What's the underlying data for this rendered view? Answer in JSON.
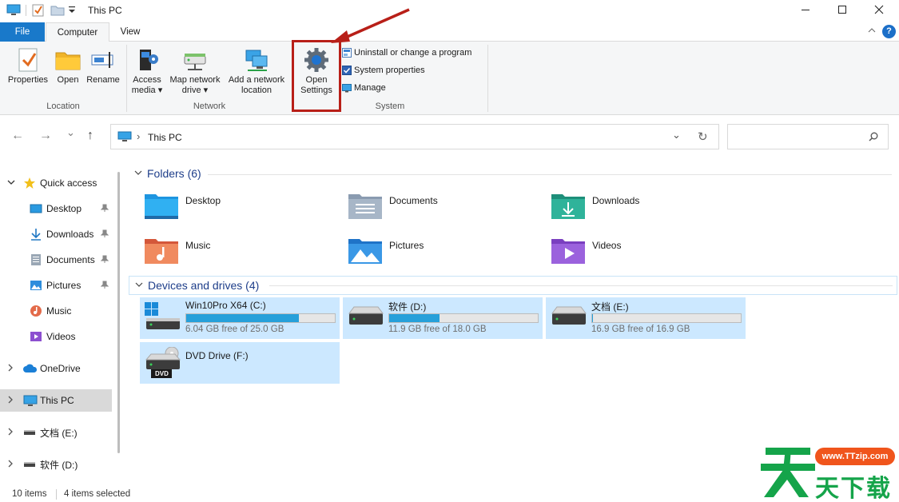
{
  "window": {
    "title": "This PC",
    "minimize": "—",
    "maximize": "☐",
    "close": "✕"
  },
  "ribbon": {
    "tabs": [
      {
        "label": "File"
      },
      {
        "label": "Computer"
      },
      {
        "label": "View"
      }
    ],
    "collapse": "^",
    "help": "?",
    "location": {
      "group_label": "Location",
      "properties": "Properties",
      "open": "Open",
      "rename": "Rename"
    },
    "network": {
      "group_label": "Network",
      "access_media_1": "Access",
      "access_media_2": "media ▾",
      "map_drive_1": "Map network",
      "map_drive_2": "drive ▾",
      "add_location_1": "Add a network",
      "add_location_2": "location"
    },
    "system": {
      "group_label": "System",
      "open_settings_1": "Open",
      "open_settings_2": "Settings",
      "uninstall": "Uninstall or change a program",
      "system_properties": "System properties",
      "manage": "Manage"
    }
  },
  "nav": {
    "back": "←",
    "forward": "→",
    "recent": "⌄",
    "up": "↑",
    "address": "This PC",
    "address_sep": "›",
    "dropdown": "⌄",
    "refresh": "↻",
    "search_placeholder": "",
    "search_glyph": "⚲"
  },
  "navpane": {
    "items": [
      {
        "label": "Quick access",
        "expanded": true
      },
      {
        "label": "Desktop",
        "pinned": true
      },
      {
        "label": "Downloads",
        "pinned": true
      },
      {
        "label": "Documents",
        "pinned": true
      },
      {
        "label": "Pictures",
        "pinned": true
      },
      {
        "label": "Music"
      },
      {
        "label": "Videos"
      },
      {
        "label": "OneDrive"
      },
      {
        "label": "This PC",
        "selected": true
      },
      {
        "label": "文档 (E:)"
      },
      {
        "label": "软件 (D:)"
      }
    ],
    "pin_glyph": "📌",
    "chev_down": "⌄",
    "chev_right": "›"
  },
  "content": {
    "folders_header": "Folders (6)",
    "folders": [
      {
        "label": "Desktop",
        "color": "#1e95e0"
      },
      {
        "label": "Documents",
        "color": "#8a9bb0"
      },
      {
        "label": "Downloads",
        "color": "#27a38c"
      },
      {
        "label": "Music",
        "color": "#e36b4a"
      },
      {
        "label": "Pictures",
        "color": "#2d8ddc"
      },
      {
        "label": "Videos",
        "color": "#8c4fd0"
      }
    ],
    "drives_header": "Devices and drives (4)",
    "drives": [
      {
        "name": "Win10Pro X64 (C:)",
        "free": "6.04 GB free of 25.0 GB",
        "used_fraction": 0.758
      },
      {
        "name": "软件 (D:)",
        "free": "11.9 GB free of 18.0 GB",
        "used_fraction": 0.339
      },
      {
        "name": "文档 (E:)",
        "free": "16.9 GB free of 16.9 GB",
        "used_fraction": 0.005
      },
      {
        "name": "DVD Drive (F:)",
        "free": "",
        "used_fraction": null,
        "badge": "DVD"
      }
    ]
  },
  "status": {
    "items": "10 items",
    "selected": "4 items selected"
  },
  "watermark": {
    "url": "www.TTzip.com",
    "chars": "天下载",
    "logo_char": "天"
  },
  "colors": {
    "accent": "#1979ca",
    "highlight_box": "#b81f18",
    "drive_fill": "#26a0da",
    "selection": "#cce8ff"
  }
}
